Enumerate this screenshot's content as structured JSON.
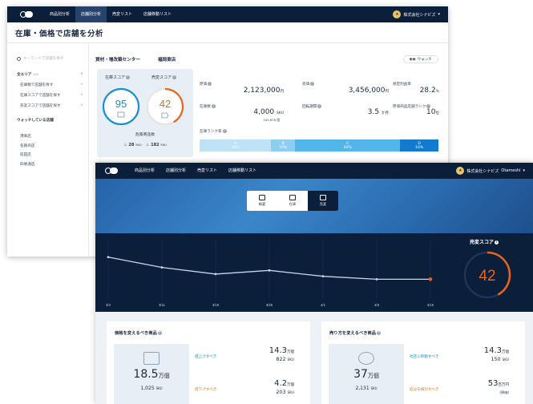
{
  "nav": {
    "items": [
      "商品別分析",
      "店舗別分析",
      "売変リスト",
      "店舗移動リスト"
    ],
    "org": "株式会社シナビズ",
    "org_user": "Otameshi"
  },
  "page": {
    "title": "在庫・価格で店舗を分析"
  },
  "sidebar": {
    "search_placeholder": "キーワードで店舗を探す",
    "area": "全エリア",
    "area_count": "(80)",
    "subs": [
      "在庫数で店舗を探す",
      "在庫スコアで店舗を探す",
      "売変スコアで店舗を探す"
    ],
    "watch_title": "ウォッチしている店舗",
    "stores": [
      "港来店",
      "名鉄商店",
      "前田店",
      "四條通店"
    ]
  },
  "store": {
    "name": "資材・増改築センター",
    "branch": "福岡東店",
    "watch": "ウォッチ",
    "stock_score_label": "在庫スコア",
    "stock_score": "95",
    "sales_score_label": "売変スコア",
    "sales_score": "42",
    "danger_label": "危険商品数",
    "danger_a": "28",
    "danger_b": "182",
    "sku": "SKU"
  },
  "metrics": {
    "stock_value_label": "原価",
    "stock_value": "2,123,000",
    "sales_value_label": "売価",
    "sales_value": "3,456,000",
    "yen": "円",
    "margin_label": "想定利益率",
    "margin": "28.2",
    "pct": "%",
    "stock_count_label": "在庫数",
    "stock_count": "4,000",
    "stock_count_sub": "345,678 個",
    "turnover_label": "回転期間",
    "turnover": "3.5",
    "month": "か月",
    "rank_label": "原価商品店舗ランク",
    "rank": "10",
    "rank_unit": "位",
    "rank_bar_label": "在庫ランク率"
  },
  "rank_bar": [
    {
      "label": "A",
      "pct": "30%",
      "share": 30,
      "color": "#bfe3f6"
    },
    {
      "label": "B",
      "pct": "10%",
      "share": 10,
      "color": "#8fcdef"
    },
    {
      "label": "C",
      "pct": "44%",
      "share": 44,
      "color": "#52b6ea"
    },
    {
      "label": "D",
      "pct": "16%",
      "share": 16,
      "color": "#127bd0"
    }
  ],
  "tabs": [
    {
      "label": "概要"
    },
    {
      "label": "在庫"
    },
    {
      "label": "売変"
    }
  ],
  "chart_data": {
    "type": "line",
    "x": [
      "3/4",
      "3/11",
      "3/18",
      "3/25",
      "4/1",
      "4/8",
      "4/15"
    ],
    "values": [
      72,
      58,
      49,
      54,
      46,
      42,
      42
    ],
    "ylim": [
      0,
      100
    ],
    "title": "",
    "xlabel": "",
    "ylabel": ""
  },
  "sales_score_panel": {
    "label": "売変スコア",
    "value": "42",
    "fraction": 0.42
  },
  "card_price": {
    "title": "価格を変えるべき商品",
    "big": "18.5",
    "big_unit": "万個",
    "big_sku": "1,025",
    "row1_label": "値上げすべき",
    "row1_main": "14.3",
    "row1_unit": "万個",
    "row1_sku": "822",
    "row2_label": "値下げすべき",
    "row2_main": "4.2",
    "row2_unit": "万個",
    "row2_sku": "203",
    "sku": "SKU"
  },
  "card_method": {
    "title": "売り方を変えるべき商品",
    "big": "37",
    "big_unit": "万個",
    "big_sku": "2,131",
    "row1_label": "他店に移動すべき",
    "row1_main": "14.3",
    "row1_unit": "万個",
    "row1_sku": "150",
    "row2_label": "処分を検討すべき",
    "row2_main": "53",
    "row2_unit": "百万円",
    "row2_sub": "(原価)",
    "sku": "SKU"
  },
  "colors": {
    "navy": "#0b1e3a",
    "blue": "#1a8fd6",
    "orange": "#e8651a"
  }
}
